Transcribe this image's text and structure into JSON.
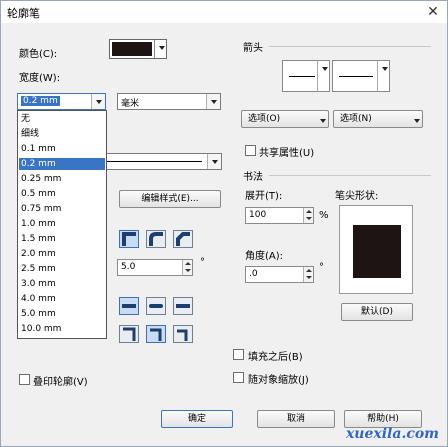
{
  "window": {
    "title": "轮廓笔",
    "close_glyph": "✕"
  },
  "color_label": "颜色(C):",
  "color_value": "#1f1414",
  "width_label": "宽度(W):",
  "width_value": "0.2 mm",
  "unit_value": "毫米",
  "width_options": [
    "无",
    "细线",
    "0.1 mm",
    "0.2 mm",
    "0.25 mm",
    "0.5 mm",
    "0.75 mm",
    "1.0 mm",
    "1.5 mm",
    "2.0 mm",
    "2.5 mm",
    "3.0 mm",
    "4.0 mm",
    "5.0 mm",
    "10.0 mm"
  ],
  "selected_option_index": 3,
  "edit_style_button": "编辑样式(E)...",
  "miter_value": "5.0",
  "degree_symbol": "°",
  "overprint_label": "叠印轮廓(V)",
  "arrows": {
    "heading": "箭头",
    "options_left": "选项(O)",
    "options_right": "选项(N)",
    "share_label": "共享属性(U)"
  },
  "calligraphy": {
    "heading": "书法",
    "stretch_label": "展开(T):",
    "stretch_value": "100",
    "percent": "%",
    "angle_label": "角度(A):",
    "angle_value": ".0",
    "nib_label": "笔尖形状:",
    "default_button": "默认(D)"
  },
  "behind_fill_label": "填充之后(B)",
  "scale_label": "随对象缩放(J)",
  "footer": {
    "ok": "确定",
    "cancel": "取消",
    "help": "帮助(H)"
  },
  "watermark": "xuexila.com"
}
